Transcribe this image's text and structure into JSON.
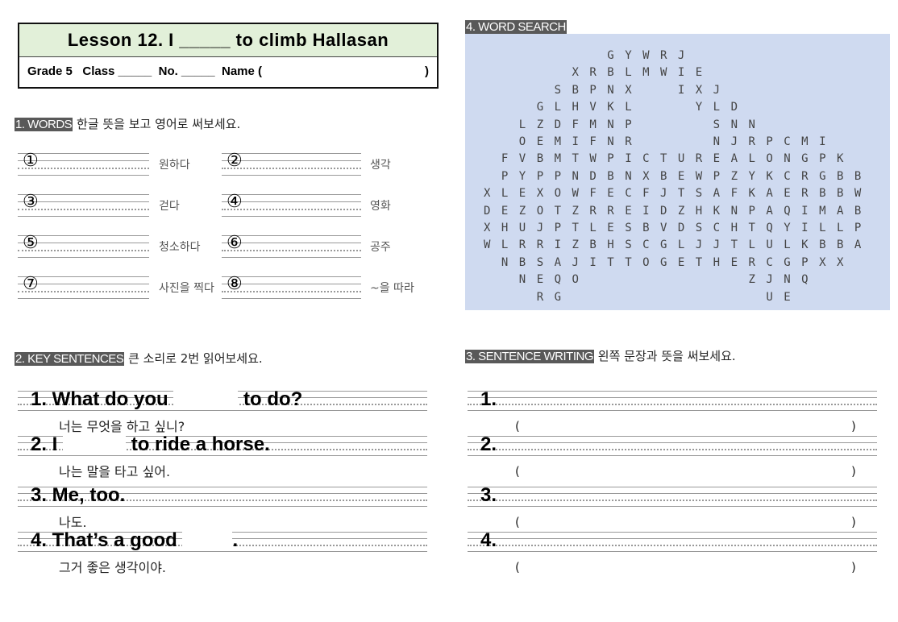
{
  "header": {
    "title": "Lesson 12. I _____ to climb Hallasan",
    "info": "Grade 5   Class _____  No. _____  Name (",
    "info_close": ")"
  },
  "words": {
    "tag": "1. WORDS",
    "instruction": "한글 뜻을 보고 영어로 써보세요.",
    "items": [
      {
        "num": "①",
        "meaning": "원하다"
      },
      {
        "num": "②",
        "meaning": "생각"
      },
      {
        "num": "③",
        "meaning": "걷다"
      },
      {
        "num": "④",
        "meaning": "영화"
      },
      {
        "num": "⑤",
        "meaning": "청소하다"
      },
      {
        "num": "⑥",
        "meaning": "공주"
      },
      {
        "num": "⑦",
        "meaning": "사진을 찍다"
      },
      {
        "num": "⑧",
        "meaning": "~을 따라"
      }
    ]
  },
  "key": {
    "tag": "2. KEY SENTENCES",
    "instruction": "큰 소리로 2번 읽어보세요.",
    "items": [
      {
        "before": "1. What do you ",
        "after": " to do?",
        "korean": "너는 무엇을 하고 싶니?"
      },
      {
        "before": "2. I ",
        "after": " to ride a horse.",
        "korean": "나는 말을 타고 싶어."
      },
      {
        "before": "3. Me, too.",
        "after": "",
        "korean": "나도."
      },
      {
        "before": "4. That’s a good ",
        "after": ".",
        "korean": "그거 좋은 생각이야."
      }
    ]
  },
  "search": {
    "tag": "4. WORD SEARCH",
    "grid": [
      "       GYWRJ          ",
      "     XRBLMWIE         ",
      "    SBPNX  IXJ        ",
      "   GLHVKL   YLD       ",
      "  LZDFMNP    SNN      ",
      "  OEMIFNR    NJRPCMI  ",
      " FVBMTWPICTUREALONGPK ",
      " PYPPNDBNXBEWPZYKCRGBB",
      "XLEXOWFECFJTSAFKAERBBW",
      "DEZOTZRREIDZHKNPAQIMAB",
      "XHUJPTLESBVDSCHTQYILLP",
      "WLRRIZBHSCGLJJTLULKBBA",
      " NBSAJITTOGETHERCGPXX ",
      "  NEQO         ZJNQ   ",
      "   RG           UE    "
    ]
  },
  "writing": {
    "tag": "3. SENTENCE WRITING",
    "instruction": "왼쪽 문장과 뜻을 써보세요.",
    "numbers": [
      "1.",
      "2.",
      "3.",
      "4."
    ],
    "open": "(",
    "close": ")"
  },
  "colors": {
    "header_bg": "#e2f0d9",
    "tag_bg": "#595959",
    "search_bg": "#cfdaf0"
  }
}
